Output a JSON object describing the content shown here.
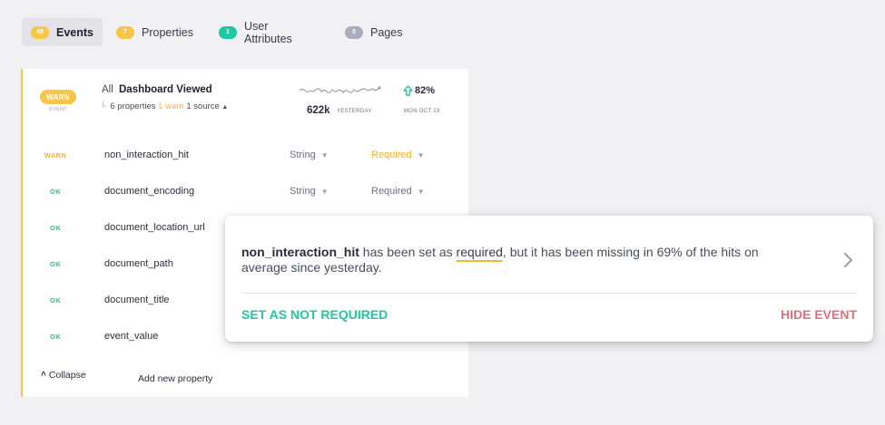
{
  "tabs": [
    {
      "count": "49",
      "label": "Events",
      "badge_color": "#f7c548",
      "active": true
    },
    {
      "count": "7",
      "label": "Properties",
      "badge_color": "#f7c548",
      "active": false
    },
    {
      "count": "1",
      "label": "User Attributes",
      "badge_color": "#1fc8a0",
      "active": false
    },
    {
      "count": "0",
      "label": "Pages",
      "badge_color": "#a9acbd",
      "active": false
    }
  ],
  "event": {
    "status_badge": "WARN",
    "status_sub": "EVENT",
    "scope": "All",
    "name": "Dashboard Viewed",
    "meta": {
      "properties": "6 properties",
      "warn": "1 warn",
      "source": "1 source",
      "toggle_icon": "triangle-up-icon"
    },
    "volume": "622k",
    "volume_period": "YESTERDAY",
    "change": "82%",
    "change_icon": "arrow-up-icon",
    "date": "MON OCT 23"
  },
  "properties": [
    {
      "status": "WARN",
      "status_type": "warn",
      "name": "non_interaction_hit",
      "type": "String",
      "required": "Required",
      "required_warn": true
    },
    {
      "status": "OK",
      "status_type": "ok",
      "name": "document_encoding",
      "type": "String",
      "required": "Required",
      "required_warn": false
    },
    {
      "status": "OK",
      "status_type": "ok",
      "name": "document_location_url"
    },
    {
      "status": "OK",
      "status_type": "ok",
      "name": "document_path"
    },
    {
      "status": "OK",
      "status_type": "ok",
      "name": "document_title"
    },
    {
      "status": "OK",
      "status_type": "ok",
      "name": "event_value"
    }
  ],
  "footer": {
    "collapse": "Collapse",
    "add_property": "Add new property"
  },
  "popup": {
    "prop_name": "non_interaction_hit",
    "text_1": " has been set as ",
    "required_word": "required",
    "text_2": ", but it has been missing in 69% of the hits on average since yesterday.",
    "action_left": "SET AS NOT REQUIRED",
    "action_right": "HIDE EVENT"
  },
  "colors": {
    "warn": "#f7c548",
    "ok": "#24c89d",
    "danger": "#e0707a",
    "accent_border": "#f5c451"
  }
}
